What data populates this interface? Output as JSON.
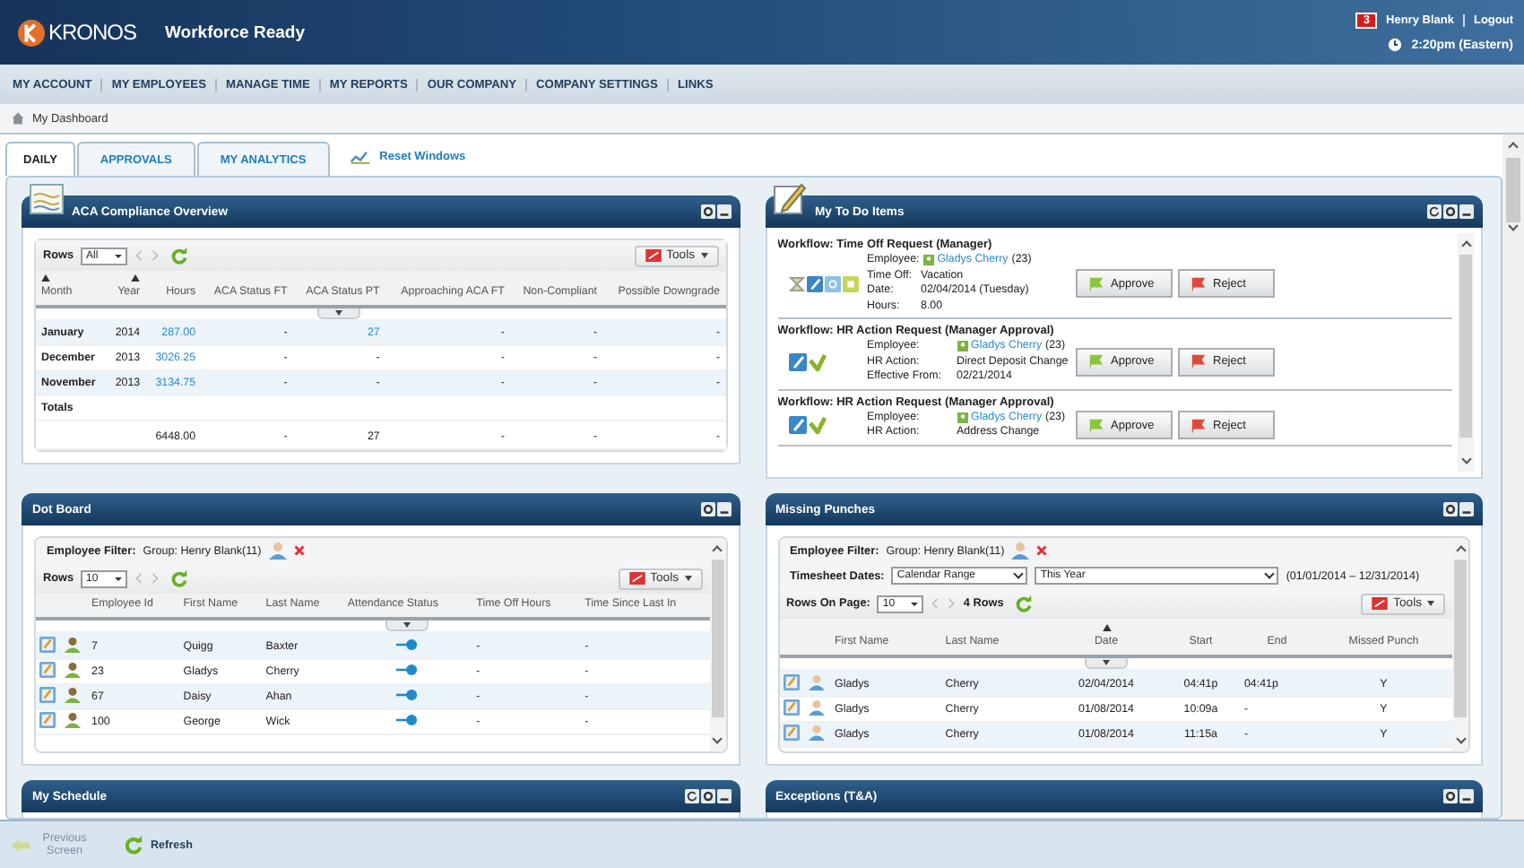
{
  "header": {
    "logo": "KRONOS",
    "product": "Workforce Ready",
    "alert_count": "3",
    "user": "Henry Blank",
    "logout": "Logout",
    "time": "2:20pm (Eastern)"
  },
  "nav": [
    "MY ACCOUNT",
    "MY EMPLOYEES",
    "MANAGE TIME",
    "MY REPORTS",
    "OUR COMPANY",
    "COMPANY SETTINGS",
    "LINKS"
  ],
  "breadcrumb": "My Dashboard",
  "tabs": [
    {
      "label": "DAILY",
      "selected": true
    },
    {
      "label": "APPROVALS",
      "selected": false
    },
    {
      "label": "MY ANALYTICS",
      "selected": false
    }
  ],
  "reset_windows": "Reset Windows",
  "aca": {
    "title": "ACA Compliance Overview",
    "refreshable": false,
    "rows_label": "Rows",
    "rows_value": "All",
    "tools": "Tools",
    "columns": [
      {
        "label": "Month",
        "sorted": true
      },
      {
        "label": "Year",
        "sorted": true
      },
      {
        "label": "Hours",
        "sorted": false
      },
      {
        "label": "ACA Status FT",
        "sorted": false
      },
      {
        "label": "ACA Status PT",
        "sorted": false
      },
      {
        "label": "Approaching ACA FT",
        "sorted": false
      },
      {
        "label": "Non-Compliant",
        "sorted": false
      },
      {
        "label": "Possible Downgrade",
        "sorted": false
      }
    ],
    "rows": [
      {
        "cells": [
          {
            "text": "January",
            "link": false
          },
          {
            "text": "2014",
            "link": false
          },
          {
            "text": "287.00",
            "link": true
          },
          {
            "text": "-",
            "link": false
          },
          {
            "text": "27",
            "link": true
          },
          {
            "text": "-",
            "link": false
          },
          {
            "text": "-",
            "link": false
          },
          {
            "text": "-",
            "link": false
          }
        ]
      },
      {
        "cells": [
          {
            "text": "December",
            "link": false
          },
          {
            "text": "2013",
            "link": false
          },
          {
            "text": "3026.25",
            "link": true
          },
          {
            "text": "-",
            "link": false
          },
          {
            "text": "-",
            "link": false
          },
          {
            "text": "-",
            "link": false
          },
          {
            "text": "-",
            "link": false
          },
          {
            "text": "-",
            "link": false
          }
        ]
      },
      {
        "cells": [
          {
            "text": "November",
            "link": false
          },
          {
            "text": "2013",
            "link": false
          },
          {
            "text": "3134.75",
            "link": true
          },
          {
            "text": "-",
            "link": false
          },
          {
            "text": "-",
            "link": false
          },
          {
            "text": "-",
            "link": false
          },
          {
            "text": "-",
            "link": false
          },
          {
            "text": "-",
            "link": false
          }
        ]
      }
    ],
    "totals": {
      "label": "Totals",
      "cells": [
        "6448.00",
        "-",
        "27",
        "-",
        "-",
        "-"
      ]
    }
  },
  "todo": {
    "title": "My To Do Items",
    "refreshable": true,
    "items": [
      {
        "kind": "time_off",
        "workflow": "Workflow: Time Off Request (Manager)",
        "fields": [
          {
            "kind": "employee",
            "label": "Employee:",
            "value": "Gladys Cherry",
            "extra": "(23)"
          },
          {
            "kind": "text",
            "label": "Time Off:",
            "value": "Vacation"
          },
          {
            "kind": "text",
            "label": "Date:",
            "value": "02/04/2014 (Tuesday)"
          },
          {
            "kind": "text",
            "label": "Hours:",
            "value": "8.00"
          }
        ],
        "approve": "Approve",
        "reject": "Reject"
      },
      {
        "kind": "hr_action",
        "workflow": "Workflow: HR Action Request (Manager Approval)",
        "fields": [
          {
            "kind": "employee",
            "label": "Employee:",
            "value": "Gladys Cherry",
            "extra": "(23)"
          },
          {
            "kind": "text",
            "label": "HR Action:",
            "value": "Direct Deposit Change"
          },
          {
            "kind": "text",
            "label": "Effective From:",
            "value": "02/21/2014"
          }
        ],
        "approve": "Approve",
        "reject": "Reject"
      },
      {
        "kind": "hr_action",
        "workflow": "Workflow: HR Action Request (Manager Approval)",
        "fields": [
          {
            "kind": "employee",
            "label": "Employee:",
            "value": "Gladys Cherry",
            "extra": "(23)"
          },
          {
            "kind": "text",
            "label": "HR Action:",
            "value": "Address Change"
          }
        ],
        "approve": "Approve",
        "reject": "Reject"
      }
    ]
  },
  "dot": {
    "title": "Dot Board",
    "refreshable": false,
    "filter_label": "Employee Filter:",
    "filter_value": "Group: Henry Blank(11)",
    "rows_label": "Rows",
    "rows_value": "10",
    "tools": "Tools",
    "columns": [
      "Employee Id",
      "First Name",
      "Last Name",
      "Attendance Status",
      "Time Off Hours",
      "Time Since Last In"
    ],
    "rows": [
      {
        "id": "7",
        "first": "Quigg",
        "last": "Baxter",
        "time_off": "-",
        "since_last_in": "-"
      },
      {
        "id": "23",
        "first": "Gladys",
        "last": "Cherry",
        "time_off": "-",
        "since_last_in": "-"
      },
      {
        "id": "67",
        "first": "Daisy",
        "last": "Ahan",
        "time_off": "-",
        "since_last_in": "-"
      },
      {
        "id": "100",
        "first": "George",
        "last": "Wick",
        "time_off": "-",
        "since_last_in": "-"
      }
    ]
  },
  "missing": {
    "title": "Missing Punches",
    "refreshable": false,
    "filter_label": "Employee Filter:",
    "filter_value": "Group: Henry Blank(11)",
    "dates_label": "Timesheet Dates:",
    "range_type": "Calendar Range",
    "range": "This Year",
    "range_dates": "(01/01/2014 – 12/31/2014)",
    "rows_label": "Rows On Page:",
    "rows_value": "10",
    "row_count": "4 Rows",
    "tools": "Tools",
    "columns": [
      {
        "label": "First Name",
        "sorted": false
      },
      {
        "label": "Last Name",
        "sorted": false
      },
      {
        "label": "Date",
        "sorted": true
      },
      {
        "label": "Start",
        "sorted": false
      },
      {
        "label": "End",
        "sorted": false
      },
      {
        "label": "Missed Punch",
        "sorted": false
      }
    ],
    "rows": [
      {
        "first": "Gladys",
        "last": "Cherry",
        "date": "02/04/2014",
        "start": "04:41p",
        "end": "04:41p",
        "missed": "Y"
      },
      {
        "first": "Gladys",
        "last": "Cherry",
        "date": "01/08/2014",
        "start": "10:09a",
        "end": "-",
        "missed": "Y"
      },
      {
        "first": "Gladys",
        "last": "Cherry",
        "date": "01/08/2014",
        "start": "11:15a",
        "end": "-",
        "missed": "Y"
      }
    ]
  },
  "schedule": {
    "title": "My Schedule",
    "refreshable": true
  },
  "exceptions": {
    "title": "Exceptions (T&A)",
    "refreshable": false
  },
  "bottom": {
    "previous": {
      "label": "Previous Screen",
      "disabled": true
    },
    "refresh": "Refresh"
  }
}
